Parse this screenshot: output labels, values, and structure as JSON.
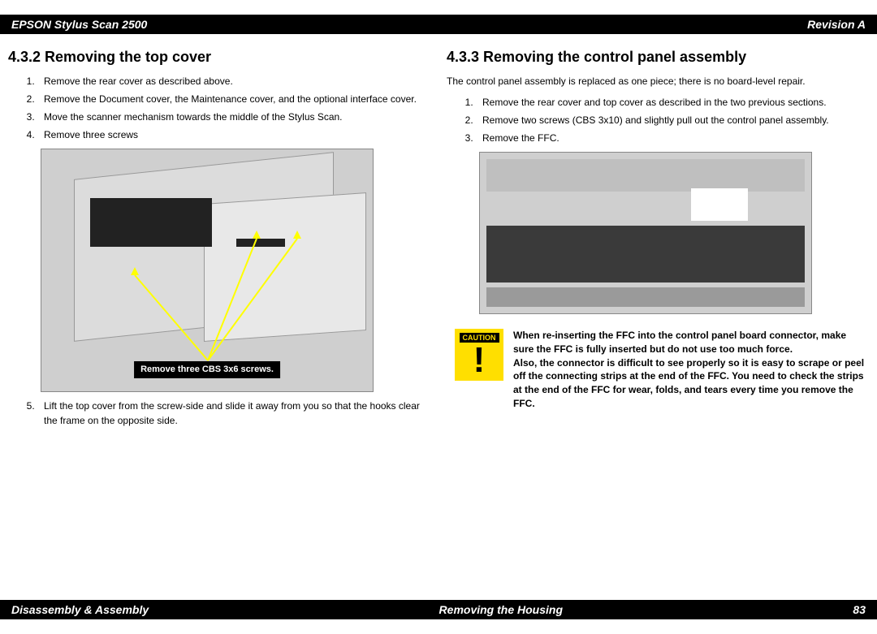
{
  "header": {
    "left": "EPSON Stylus Scan 2500",
    "right": "Revision A"
  },
  "footer": {
    "left": "Disassembly & Assembly",
    "center": "Removing the Housing",
    "right": "83"
  },
  "left_col": {
    "heading": "4.3.2  Removing the top cover",
    "steps_a": [
      "Remove the rear cover as described above.",
      "Remove the Document cover, the Maintenance cover, and the optional interface cover.",
      "Move the scanner mechanism towards the middle of the Stylus Scan.",
      "Remove three screws"
    ],
    "callout": "Remove three CBS 3x6 screws.",
    "steps_b_start": 5,
    "steps_b": [
      "Lift the top cover from the screw-side and slide it away from you so that the hooks clear the frame on the opposite side."
    ]
  },
  "right_col": {
    "heading": "4.3.3  Removing the control panel assembly",
    "intro": "The control panel assembly is replaced as one piece; there is no board-level repair.",
    "steps": [
      "Remove the rear cover and top cover as described in the two previous sections.",
      "Remove two screws (CBS 3x10) and slightly pull out the control panel assembly.",
      "Remove the FFC."
    ],
    "caution_label": "CAUTION",
    "caution_text": "When re-inserting the FFC into the control panel board connector, make sure the FFC is fully inserted but do not use too much force.\nAlso, the connector is difficult to see properly so it is easy to scrape or peel off the connecting strips at the end of the FFC. You need to check the strips at the end of the FFC for wear, folds, and tears every time you remove the FFC."
  }
}
